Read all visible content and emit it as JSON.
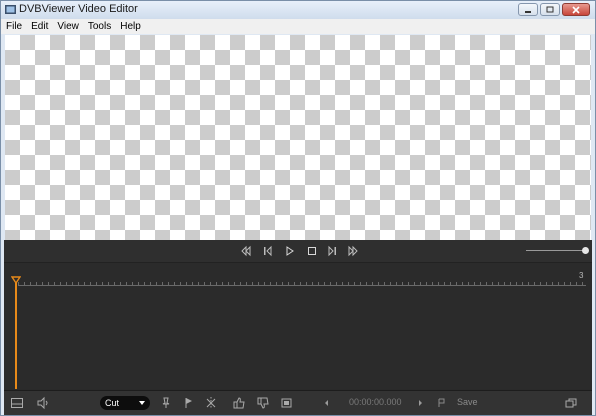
{
  "window": {
    "title": "DVBViewer Video Editor"
  },
  "menu": {
    "items": [
      "File",
      "Edit",
      "View",
      "Tools",
      "Help"
    ]
  },
  "timeline": {
    "end_marker": "3",
    "zoom_level": 1.0
  },
  "bottom": {
    "cut_mode": "Cut",
    "time": "00:00:00.000",
    "save_label": "Save"
  },
  "colors": {
    "accent": "#e88a1a",
    "panel": "#2b2b2b"
  }
}
